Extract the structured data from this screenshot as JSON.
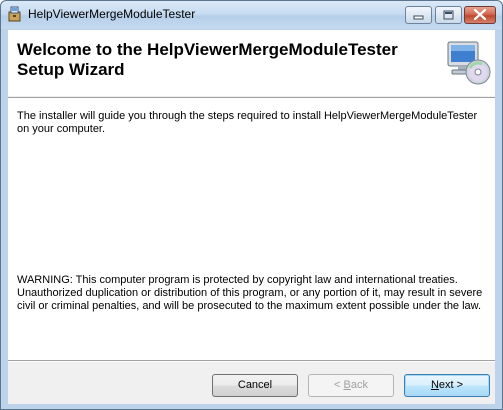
{
  "window": {
    "title": "HelpViewerMergeModuleTester",
    "icon": "installer-icon",
    "controls": [
      "minimize-icon",
      "maximize-icon",
      "close-icon"
    ]
  },
  "banner": {
    "title": "Welcome to the HelpViewerMergeModuleTester Setup Wizard",
    "icon": "computer-disc-icon"
  },
  "content": {
    "intro": "The installer will guide you through the steps required to install HelpViewerMergeModuleTester on your computer.",
    "warning": "WARNING: This computer program is protected by copyright law and international treaties. Unauthorized duplication or distribution of this program, or any portion of it, may result in severe civil or criminal penalties, and will be prosecuted to the maximum extent possible under the law."
  },
  "buttons": {
    "cancel": "Cancel",
    "back_mnemonic": "B",
    "back_rest": "ack",
    "back_prefix": "< ",
    "next_mnemonic": "N",
    "next_rest": "ext >"
  }
}
